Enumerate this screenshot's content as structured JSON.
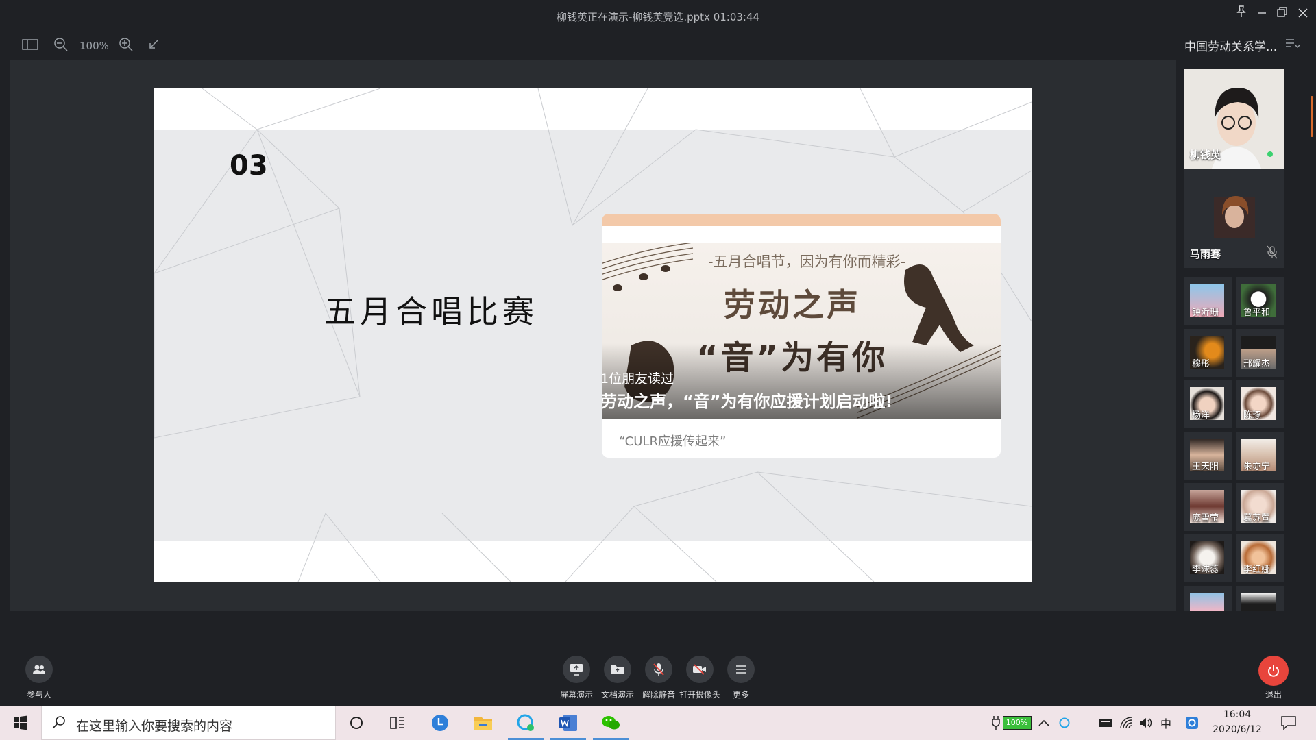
{
  "window": {
    "title": "柳钱英正在演示-柳钱英竞选.pptx 01:03:44"
  },
  "toolbar": {
    "zoom_level": "100%"
  },
  "slide": {
    "number": "03",
    "title": "五月合唱比赛",
    "article": {
      "image_line1": "-五月合唱节，因为有你而精彩-",
      "image_line2": "劳动之声",
      "image_line3": "“音”为有你",
      "readers": "1位朋友读过",
      "headline": "劳动之声，“音”为有你应援计划启动啦!",
      "caption": "“CULR应援传起来”"
    }
  },
  "panel": {
    "meeting_name": "中国劳动关系学...",
    "main_participants": [
      {
        "name": "柳钱英"
      },
      {
        "name": "马雨骞"
      }
    ],
    "participants": [
      {
        "name": "钟沂珊"
      },
      {
        "name": "鲁平和"
      },
      {
        "name": "穆彤"
      },
      {
        "name": "邢耀杰"
      },
      {
        "name": "杨洋"
      },
      {
        "name": "陈琢"
      },
      {
        "name": "王天阳"
      },
      {
        "name": "朱亦宁"
      },
      {
        "name": "庞雪莹"
      },
      {
        "name": "葛苏萱"
      },
      {
        "name": "李沫蕊"
      },
      {
        "name": "李红娜"
      }
    ]
  },
  "controls": {
    "participants_label": "参与人",
    "screen_share_label": "屏幕演示",
    "doc_share_label": "文档演示",
    "unmute_label": "解除静音",
    "camera_label": "打开摄像头",
    "more_label": "更多",
    "exit_label": "退出"
  },
  "taskbar": {
    "search_placeholder": "在这里输入你要搜索的内容",
    "battery": "100%",
    "ime": "中",
    "time": "16:04",
    "date": "2020/6/12"
  },
  "colors": {
    "background": "#1f2125",
    "stage": "#2a2d31",
    "exit_button": "#e8453c",
    "taskbar": "#f0e4e8"
  }
}
